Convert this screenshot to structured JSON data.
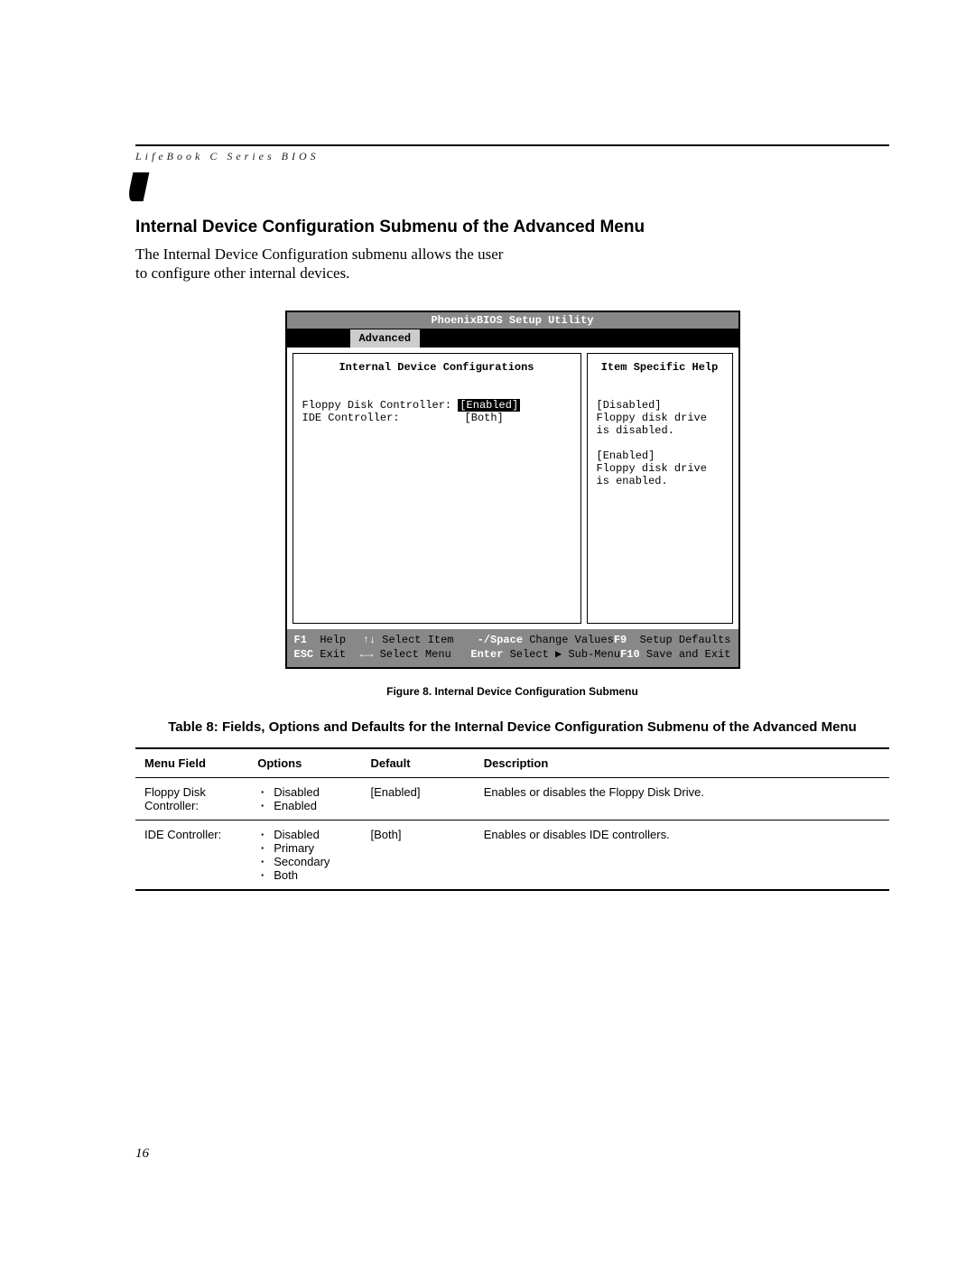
{
  "header": {
    "running_head": "LifeBook C Series BIOS",
    "section_heading": "Internal Device Configuration Submenu of the Advanced Menu",
    "intro": "The Internal Device Configuration submenu allows the user to configure other internal devices."
  },
  "bios": {
    "title": "PhoenixBIOS Setup Utility",
    "active_tab": "Advanced",
    "left_title": "Internal Device Configurations",
    "right_title": "Item Specific Help",
    "fields": {
      "floppy_label": "Floppy Disk Controller:",
      "floppy_value": "[Enabled]",
      "ide_label": "IDE Controller:",
      "ide_value": "[Both]"
    },
    "help": {
      "disabled_label": "[Disabled]",
      "disabled_text": "Floppy disk drive is disabled.",
      "enabled_label": "[Enabled]",
      "enabled_text": "Floppy disk drive is enabled."
    },
    "footer": {
      "f1_key": "F1",
      "f1_label": "Help",
      "updown_key": "↑↓",
      "updown_label": "Select Item",
      "minus_key": "-/Space",
      "minus_label": "Change Values",
      "f9_key": "F9",
      "f9_label": "Setup Defaults",
      "esc_key": "ESC",
      "esc_label": "Exit",
      "lr_key": "←→",
      "lr_label": "Select Menu",
      "enter_key": "Enter",
      "enter_label": "Select ▶ Sub-Menu",
      "f10_key": "F10",
      "f10_label": "Save and Exit"
    }
  },
  "figure_caption": "Figure 8.  Internal Device Configuration Submenu",
  "table": {
    "title": "Table 8: Fields, Options and Defaults for the Internal Device Configuration Submenu of the Advanced Menu",
    "headers": {
      "field": "Menu Field",
      "options": "Options",
      "def": "Default",
      "desc": "Description"
    },
    "rows": [
      {
        "field": "Floppy Disk Controller:",
        "options": [
          "Disabled",
          "Enabled"
        ],
        "def": "[Enabled]",
        "desc": "Enables or disables the Floppy Disk Drive."
      },
      {
        "field": "IDE Controller:",
        "options": [
          "Disabled",
          "Primary",
          "Secondary",
          "Both"
        ],
        "def": "[Both]",
        "desc": "Enables or disables IDE controllers."
      }
    ]
  },
  "page_number": "16"
}
